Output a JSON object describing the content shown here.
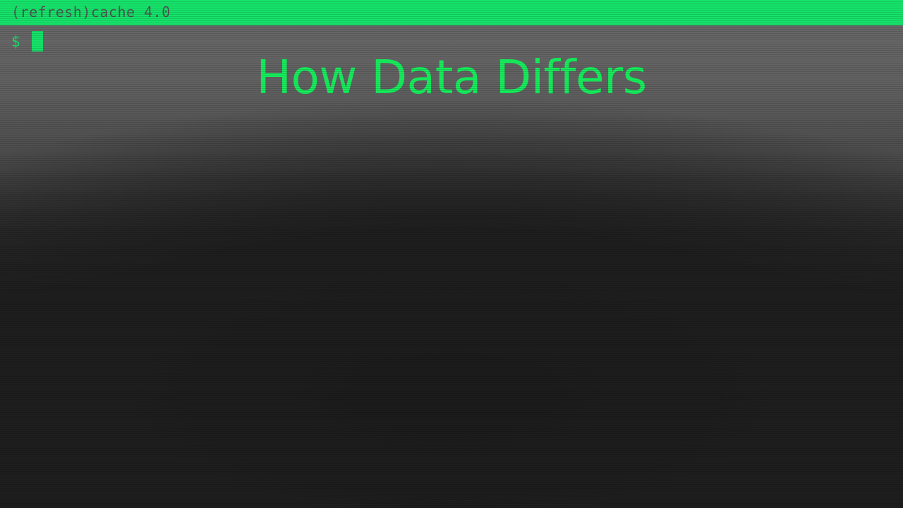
{
  "window": {
    "title": "(refresh)cache 4.0"
  },
  "terminal": {
    "prompt": "$"
  },
  "slide": {
    "heading": "How Data Differs"
  },
  "colors": {
    "accent": "#16e36a",
    "heading": "#16ee5c",
    "background_top": "#6a6a6a",
    "background_bottom": "#1e1e1e"
  }
}
